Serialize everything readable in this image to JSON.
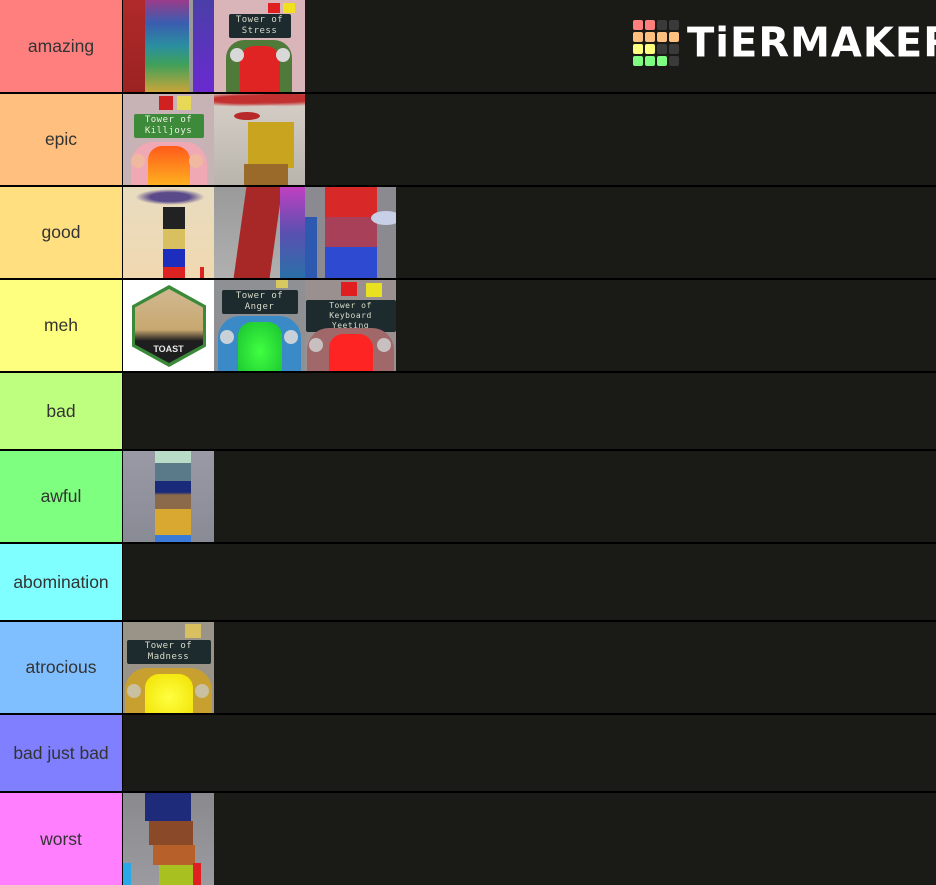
{
  "app": {
    "brand": "TiERMAKER"
  },
  "logo": {
    "grid_colors": [
      "#ff7f7f",
      "#ff7f7f",
      "#3a3a3a",
      "#3a3a3a",
      "#ffbf7f",
      "#ffbf7f",
      "#ffbf7f",
      "#ffbf7f",
      "#ffff7f",
      "#ffff7f",
      "#3a3a3a",
      "#3a3a3a",
      "#7fff7f",
      "#7fff7f",
      "#7fff7f",
      "#3a3a3a"
    ]
  },
  "tiers": [
    {
      "label": "amazing",
      "color": "#ff7f7f",
      "items": [
        {
          "name": "rainbow-tower-image",
          "caption": ""
        },
        {
          "name": "tower-of-stress-image",
          "caption": "Tower of Stress"
        }
      ]
    },
    {
      "label": "epic",
      "color": "#ffbf7f",
      "items": [
        {
          "name": "tower-of-killjoys-image",
          "caption": "Tower of Killjoys"
        },
        {
          "name": "yellow-block-sky-image",
          "caption": ""
        }
      ]
    },
    {
      "label": "good",
      "color": "#ffdf7f",
      "items": [
        {
          "name": "stacked-blocks-image",
          "caption": ""
        },
        {
          "name": "red-beam-image",
          "caption": ""
        },
        {
          "name": "purple-red-tower-image",
          "caption": ""
        }
      ]
    },
    {
      "label": "meh",
      "color": "#ffff7f",
      "items": [
        {
          "name": "toast-badge-image",
          "caption": "TOAST"
        },
        {
          "name": "tower-of-anger-image",
          "caption": "Tower of Anger"
        },
        {
          "name": "tower-of-keyboard-yeeting-image",
          "caption": "Tower of Keyboard Yeeting"
        }
      ]
    },
    {
      "label": "bad",
      "color": "#bfff7f",
      "items": []
    },
    {
      "label": "awful",
      "color": "#7fff7f",
      "items": [
        {
          "name": "pale-tower-image",
          "caption": ""
        }
      ]
    },
    {
      "label": "abomination",
      "color": "#7fffff",
      "items": []
    },
    {
      "label": "atrocious",
      "color": "#7fbfff",
      "items": [
        {
          "name": "tower-of-madness-image",
          "caption": "Tower of Madness"
        }
      ]
    },
    {
      "label": "bad just bad",
      "color": "#7f7fff",
      "items": []
    },
    {
      "label": "worst",
      "color": "#ff7fff",
      "items": [
        {
          "name": "glass-tower-image",
          "caption": ""
        }
      ]
    }
  ]
}
